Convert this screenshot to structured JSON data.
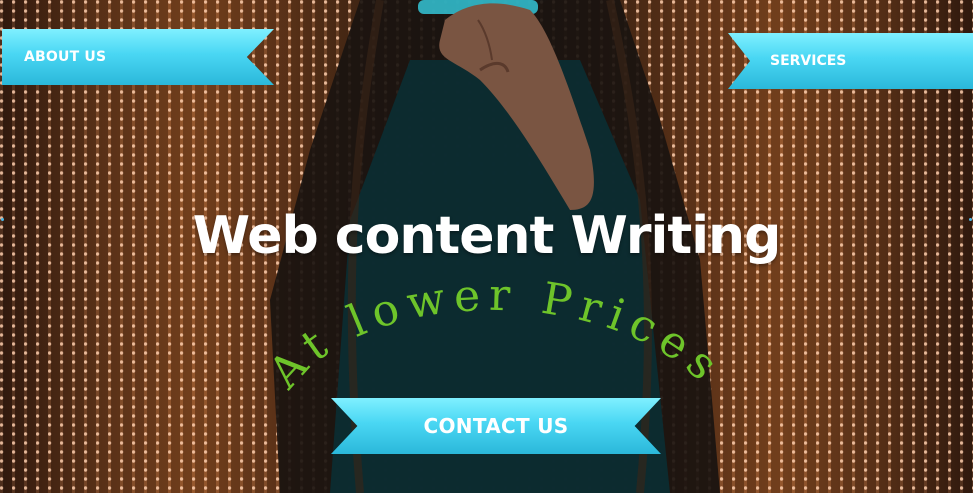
{
  "nav": {
    "about_label": "ABOUT US",
    "services_label": "SERVICES"
  },
  "hero": {
    "headline": "Web content Writing",
    "subheadline": "At lower Prices",
    "cta_label": "CONTACT US"
  },
  "colors": {
    "ribbon": "#49d6f3",
    "headline": "#ffffff",
    "subheadline": "#6ec42a"
  }
}
